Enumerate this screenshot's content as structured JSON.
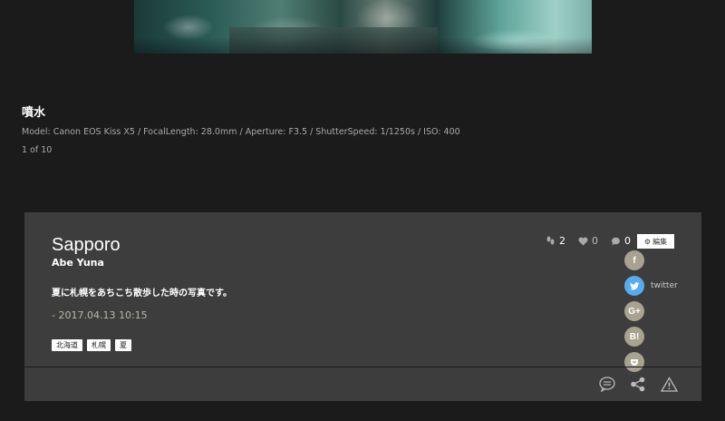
{
  "photo": {
    "alt_icon": "fountain-photo"
  },
  "info": {
    "title": "噴水",
    "meta": "Model: Canon EOS Kiss X5 / FocalLength: 28.0mm / Aperture: F3.5 / ShutterSpeed: 1/1250s / ISO: 400",
    "counter": "1 of 10"
  },
  "card": {
    "title": "Sapporo",
    "author": "Abe Yuna",
    "description": "夏に札幌をあちこち散歩した時の写真です。",
    "date": "- 2017.04.13 10:15",
    "tags": [
      "北海道",
      "札幌",
      "夏"
    ],
    "stats": {
      "footprints": "2",
      "likes": "0",
      "comments": "0"
    },
    "edit_label": "編集",
    "share": {
      "facebook": "f",
      "twitter": "twitter",
      "google": "G+",
      "hatena": "B!",
      "pocket": "pocket"
    }
  },
  "colors": {
    "background": "#1b1b1b",
    "card": "#3d3d3d",
    "share_circle": "#a8a290",
    "twitter": "#55acee"
  }
}
